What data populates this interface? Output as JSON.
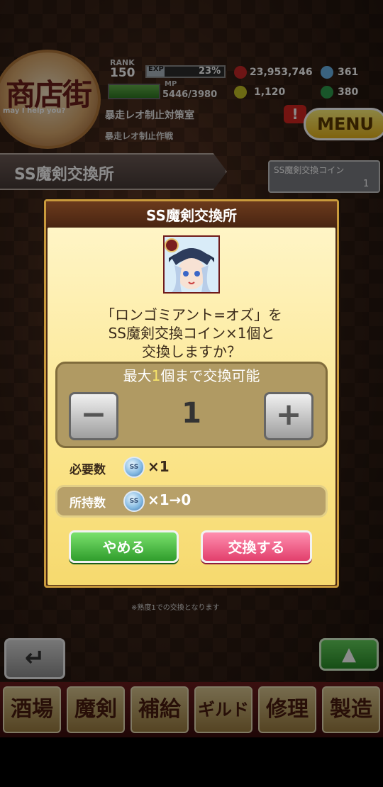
{
  "header": {
    "logo_text": "商店街",
    "logo_sub": "may I help you?",
    "rank_label": "RANK",
    "rank_value": "150",
    "exp_label": "EXP",
    "exp_percent": "23%",
    "exp_fraction": 0.23,
    "mp_label": "MP",
    "mp_value": "5446/3980",
    "resource_red": "23,953,746",
    "resource_blue": "361",
    "resource_gold": "1,120",
    "resource_green": "380",
    "subtitle1": "暴走レオ制止対策室",
    "subtitle2": "暴走レオ制止作戦",
    "alert": "!",
    "menu": "MENU"
  },
  "page": {
    "tab_title": "SS魔剣交換所",
    "coin_label": "SS魔剣交換コイン",
    "coin_count": "1"
  },
  "modal": {
    "title": "SS魔剣交換所",
    "confirm_line1": "「ロンゴミアント=オズ」を",
    "confirm_line2": "SS魔剣交換コイン×1個と",
    "confirm_line3": "交換しますか？",
    "max_prefix": "最大",
    "max_value": "1",
    "max_suffix": "個まで交換可能",
    "minus": "−",
    "plus": "+",
    "quantity": "1",
    "required_label": "必要数",
    "required_qty": "×1",
    "owned_label": "所持数",
    "owned_qty": "×1→0",
    "coin_icon_text": "SS",
    "cancel": "やめる",
    "confirm": "交換する"
  },
  "footer": {
    "note": "※熟度1での交換となります",
    "back": "↵",
    "up": "▲",
    "nav": [
      "酒場",
      "魔剣",
      "補給",
      "ギルド",
      "修理",
      "製造"
    ]
  },
  "colors": {
    "cancel_button": "#3fb13a",
    "confirm_button": "#ef5a82",
    "modal_frame": "#c99a3c",
    "modal_body": "#fcea9e"
  }
}
